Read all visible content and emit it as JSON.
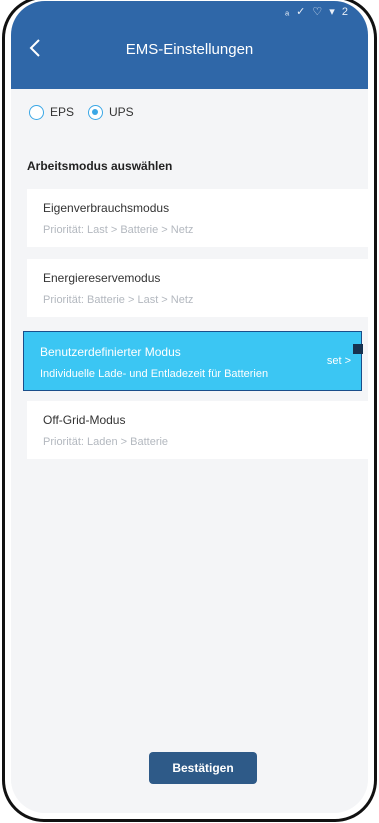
{
  "header": {
    "title": "EMS-Einstellungen",
    "back_icon": "chevron-left-icon",
    "status": "ₐ ✓ ♡ ▾ 2"
  },
  "mode_toggle": {
    "options": [
      {
        "label": "EPS",
        "checked": false
      },
      {
        "label": "UPS",
        "checked": true
      }
    ]
  },
  "section": {
    "title": "Arbeitsmodus auswählen"
  },
  "work_modes": [
    {
      "name": "Eigenverbrauchsmodus",
      "desc": "Priorität: Last > Batterie > Netz"
    },
    {
      "name": "Energiereservemodus",
      "desc": "Priorität: Batterie > Last > Netz"
    },
    {
      "name": "Benutzerdefinierter Modus",
      "desc": "Individuelle Lade- und Entladezeit für Batterien",
      "action": "set >",
      "selected": true
    },
    {
      "name": "Off-Grid-Modus",
      "desc": "Priorität: Laden > Batterie"
    }
  ],
  "confirm_button": {
    "label": "Bestätigen"
  },
  "colors": {
    "header_bg": "#2f67a8",
    "selected_card": "#3bc6f3",
    "radio_accent": "#3aa7e6",
    "button_bg": "#2e5a88"
  }
}
